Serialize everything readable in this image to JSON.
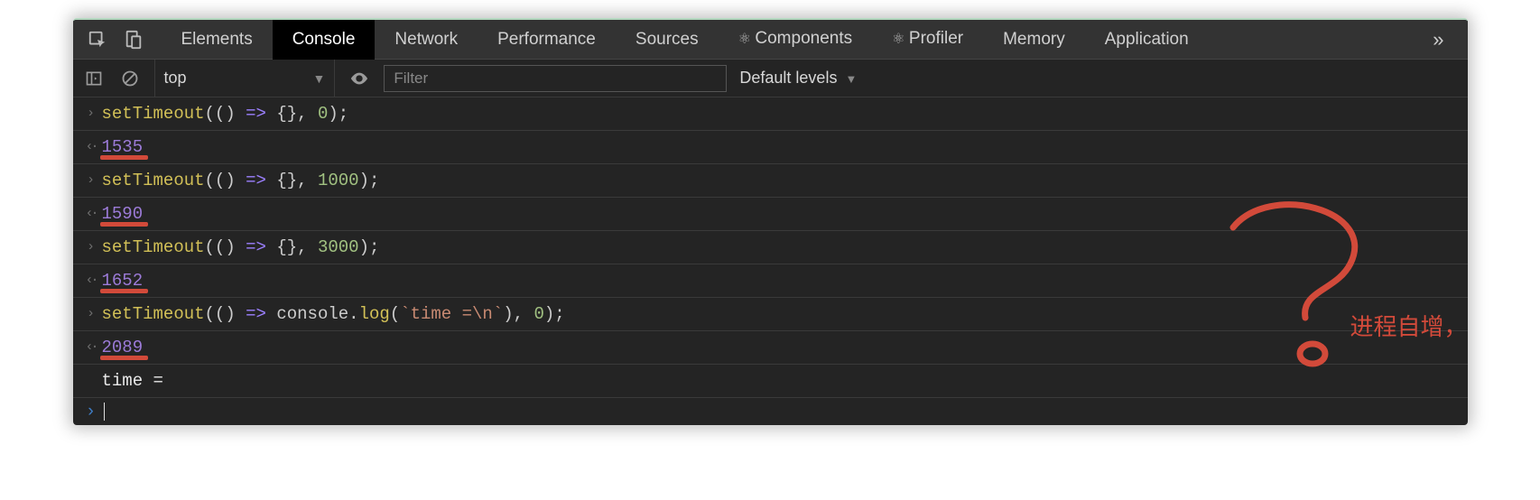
{
  "tabs": {
    "elements": "Elements",
    "console": "Console",
    "network": "Network",
    "performance": "Performance",
    "sources": "Sources",
    "components": "Components",
    "profiler": "Profiler",
    "memory": "Memory",
    "application": "Application"
  },
  "toolbar": {
    "context": "top",
    "filter_placeholder": "Filter",
    "levels": "Default levels"
  },
  "console": {
    "rows": [
      {
        "kind": "input",
        "tokens": [
          [
            "fn",
            "setTimeout"
          ],
          [
            "op",
            "(() "
          ],
          [
            "kw",
            "=>"
          ],
          [
            "op",
            " {}, "
          ],
          [
            "num",
            "0"
          ],
          [
            "op",
            ");"
          ]
        ]
      },
      {
        "kind": "output",
        "value": "1535"
      },
      {
        "kind": "input",
        "tokens": [
          [
            "fn",
            "setTimeout"
          ],
          [
            "op",
            "(() "
          ],
          [
            "kw",
            "=>"
          ],
          [
            "op",
            " {}, "
          ],
          [
            "num",
            "1000"
          ],
          [
            "op",
            ");"
          ]
        ]
      },
      {
        "kind": "output",
        "value": "1590"
      },
      {
        "kind": "input",
        "tokens": [
          [
            "fn",
            "setTimeout"
          ],
          [
            "op",
            "(() "
          ],
          [
            "kw",
            "=>"
          ],
          [
            "op",
            " {}, "
          ],
          [
            "num",
            "3000"
          ],
          [
            "op",
            ");"
          ]
        ]
      },
      {
        "kind": "output",
        "value": "1652"
      },
      {
        "kind": "input",
        "tokens": [
          [
            "fn",
            "setTimeout"
          ],
          [
            "op",
            "(() "
          ],
          [
            "kw",
            "=>"
          ],
          [
            "op",
            " console."
          ],
          [
            "fn",
            "log"
          ],
          [
            "op",
            "("
          ],
          [
            "str",
            "`time =\\n`"
          ],
          [
            "op",
            "), "
          ],
          [
            "num",
            "0"
          ],
          [
            "op",
            ");"
          ]
        ]
      },
      {
        "kind": "output",
        "value": "2089"
      },
      {
        "kind": "log",
        "text": "time ="
      }
    ]
  },
  "annotation": {
    "text": "进程自增，单位 ms ?"
  }
}
